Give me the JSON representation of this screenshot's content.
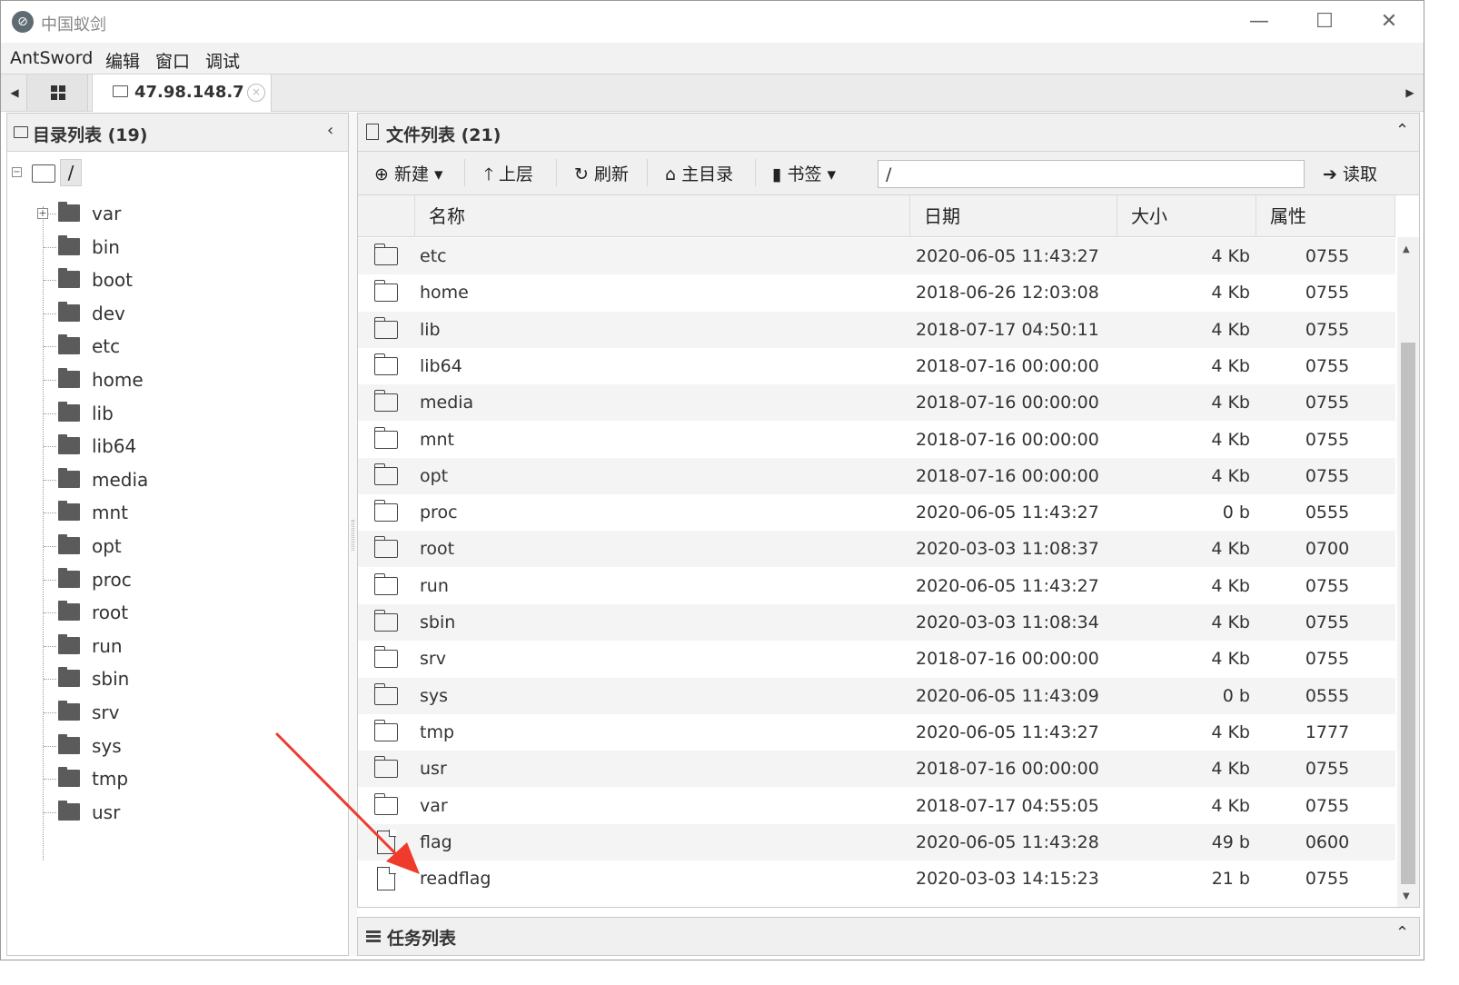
{
  "window": {
    "title": "中国蚁剑",
    "minimize": "—",
    "maximize": "☐",
    "close": "✕"
  },
  "menu": [
    "AntSword",
    "编辑",
    "窗口",
    "调试"
  ],
  "tabs": {
    "server_label": "47.98.148.7",
    "close_glyph": "×",
    "left_arrow": "◀",
    "right_arrow": "▶"
  },
  "dir_panel": {
    "title": "目录列表 (19)",
    "collapse_glyph": "‹",
    "root_label": "/",
    "root_toggle": "−",
    "items": [
      {
        "label": "var",
        "expandable": true
      },
      {
        "label": "bin"
      },
      {
        "label": "boot"
      },
      {
        "label": "dev"
      },
      {
        "label": "etc"
      },
      {
        "label": "home"
      },
      {
        "label": "lib"
      },
      {
        "label": "lib64"
      },
      {
        "label": "media"
      },
      {
        "label": "mnt"
      },
      {
        "label": "opt"
      },
      {
        "label": "proc"
      },
      {
        "label": "root"
      },
      {
        "label": "run"
      },
      {
        "label": "sbin"
      },
      {
        "label": "srv"
      },
      {
        "label": "sys"
      },
      {
        "label": "tmp"
      },
      {
        "label": "usr"
      }
    ]
  },
  "file_panel": {
    "title": "文件列表 (21)",
    "collapse_glyph": "⌃",
    "toolbar": {
      "new_label": "⊕ 新建 ▾",
      "up_label": "🡑 上层",
      "refresh_label": "↻ 刷新",
      "home_label": "⌂ 主目录",
      "bookmark_label": "▮ 书签 ▾",
      "path_value": "/",
      "read_label": "➔ 读取"
    },
    "columns": [
      "名称",
      "日期",
      "大小",
      "属性"
    ],
    "rows": [
      {
        "type": "folder",
        "name": "etc",
        "date": "2020-06-05 11:43:27",
        "size": "4 Kb",
        "attr": "0755"
      },
      {
        "type": "folder",
        "name": "home",
        "date": "2018-06-26 12:03:08",
        "size": "4 Kb",
        "attr": "0755"
      },
      {
        "type": "folder",
        "name": "lib",
        "date": "2018-07-17 04:50:11",
        "size": "4 Kb",
        "attr": "0755"
      },
      {
        "type": "folder",
        "name": "lib64",
        "date": "2018-07-16 00:00:00",
        "size": "4 Kb",
        "attr": "0755"
      },
      {
        "type": "folder",
        "name": "media",
        "date": "2018-07-16 00:00:00",
        "size": "4 Kb",
        "attr": "0755"
      },
      {
        "type": "folder",
        "name": "mnt",
        "date": "2018-07-16 00:00:00",
        "size": "4 Kb",
        "attr": "0755"
      },
      {
        "type": "folder",
        "name": "opt",
        "date": "2018-07-16 00:00:00",
        "size": "4 Kb",
        "attr": "0755"
      },
      {
        "type": "folder",
        "name": "proc",
        "date": "2020-06-05 11:43:27",
        "size": "0 b",
        "attr": "0555"
      },
      {
        "type": "folder",
        "name": "root",
        "date": "2020-03-03 11:08:37",
        "size": "4 Kb",
        "attr": "0700"
      },
      {
        "type": "folder",
        "name": "run",
        "date": "2020-06-05 11:43:27",
        "size": "4 Kb",
        "attr": "0755"
      },
      {
        "type": "folder",
        "name": "sbin",
        "date": "2020-03-03 11:08:34",
        "size": "4 Kb",
        "attr": "0755"
      },
      {
        "type": "folder",
        "name": "srv",
        "date": "2018-07-16 00:00:00",
        "size": "4 Kb",
        "attr": "0755"
      },
      {
        "type": "folder",
        "name": "sys",
        "date": "2020-06-05 11:43:09",
        "size": "0 b",
        "attr": "0555"
      },
      {
        "type": "folder",
        "name": "tmp",
        "date": "2020-06-05 11:43:27",
        "size": "4 Kb",
        "attr": "1777"
      },
      {
        "type": "folder",
        "name": "usr",
        "date": "2018-07-16 00:00:00",
        "size": "4 Kb",
        "attr": "0755"
      },
      {
        "type": "folder",
        "name": "var",
        "date": "2018-07-17 04:55:05",
        "size": "4 Kb",
        "attr": "0755"
      },
      {
        "type": "file",
        "name": "flag",
        "date": "2020-06-05 11:43:28",
        "size": "49 b",
        "attr": "0600"
      },
      {
        "type": "file",
        "name": "readflag",
        "date": "2020-03-03 14:15:23",
        "size": "21 b",
        "attr": "0755"
      }
    ]
  },
  "task_panel": {
    "title": "任务列表",
    "collapse_glyph": "⌃"
  },
  "annotation": {
    "arrow_color": "#ee3b2c"
  }
}
